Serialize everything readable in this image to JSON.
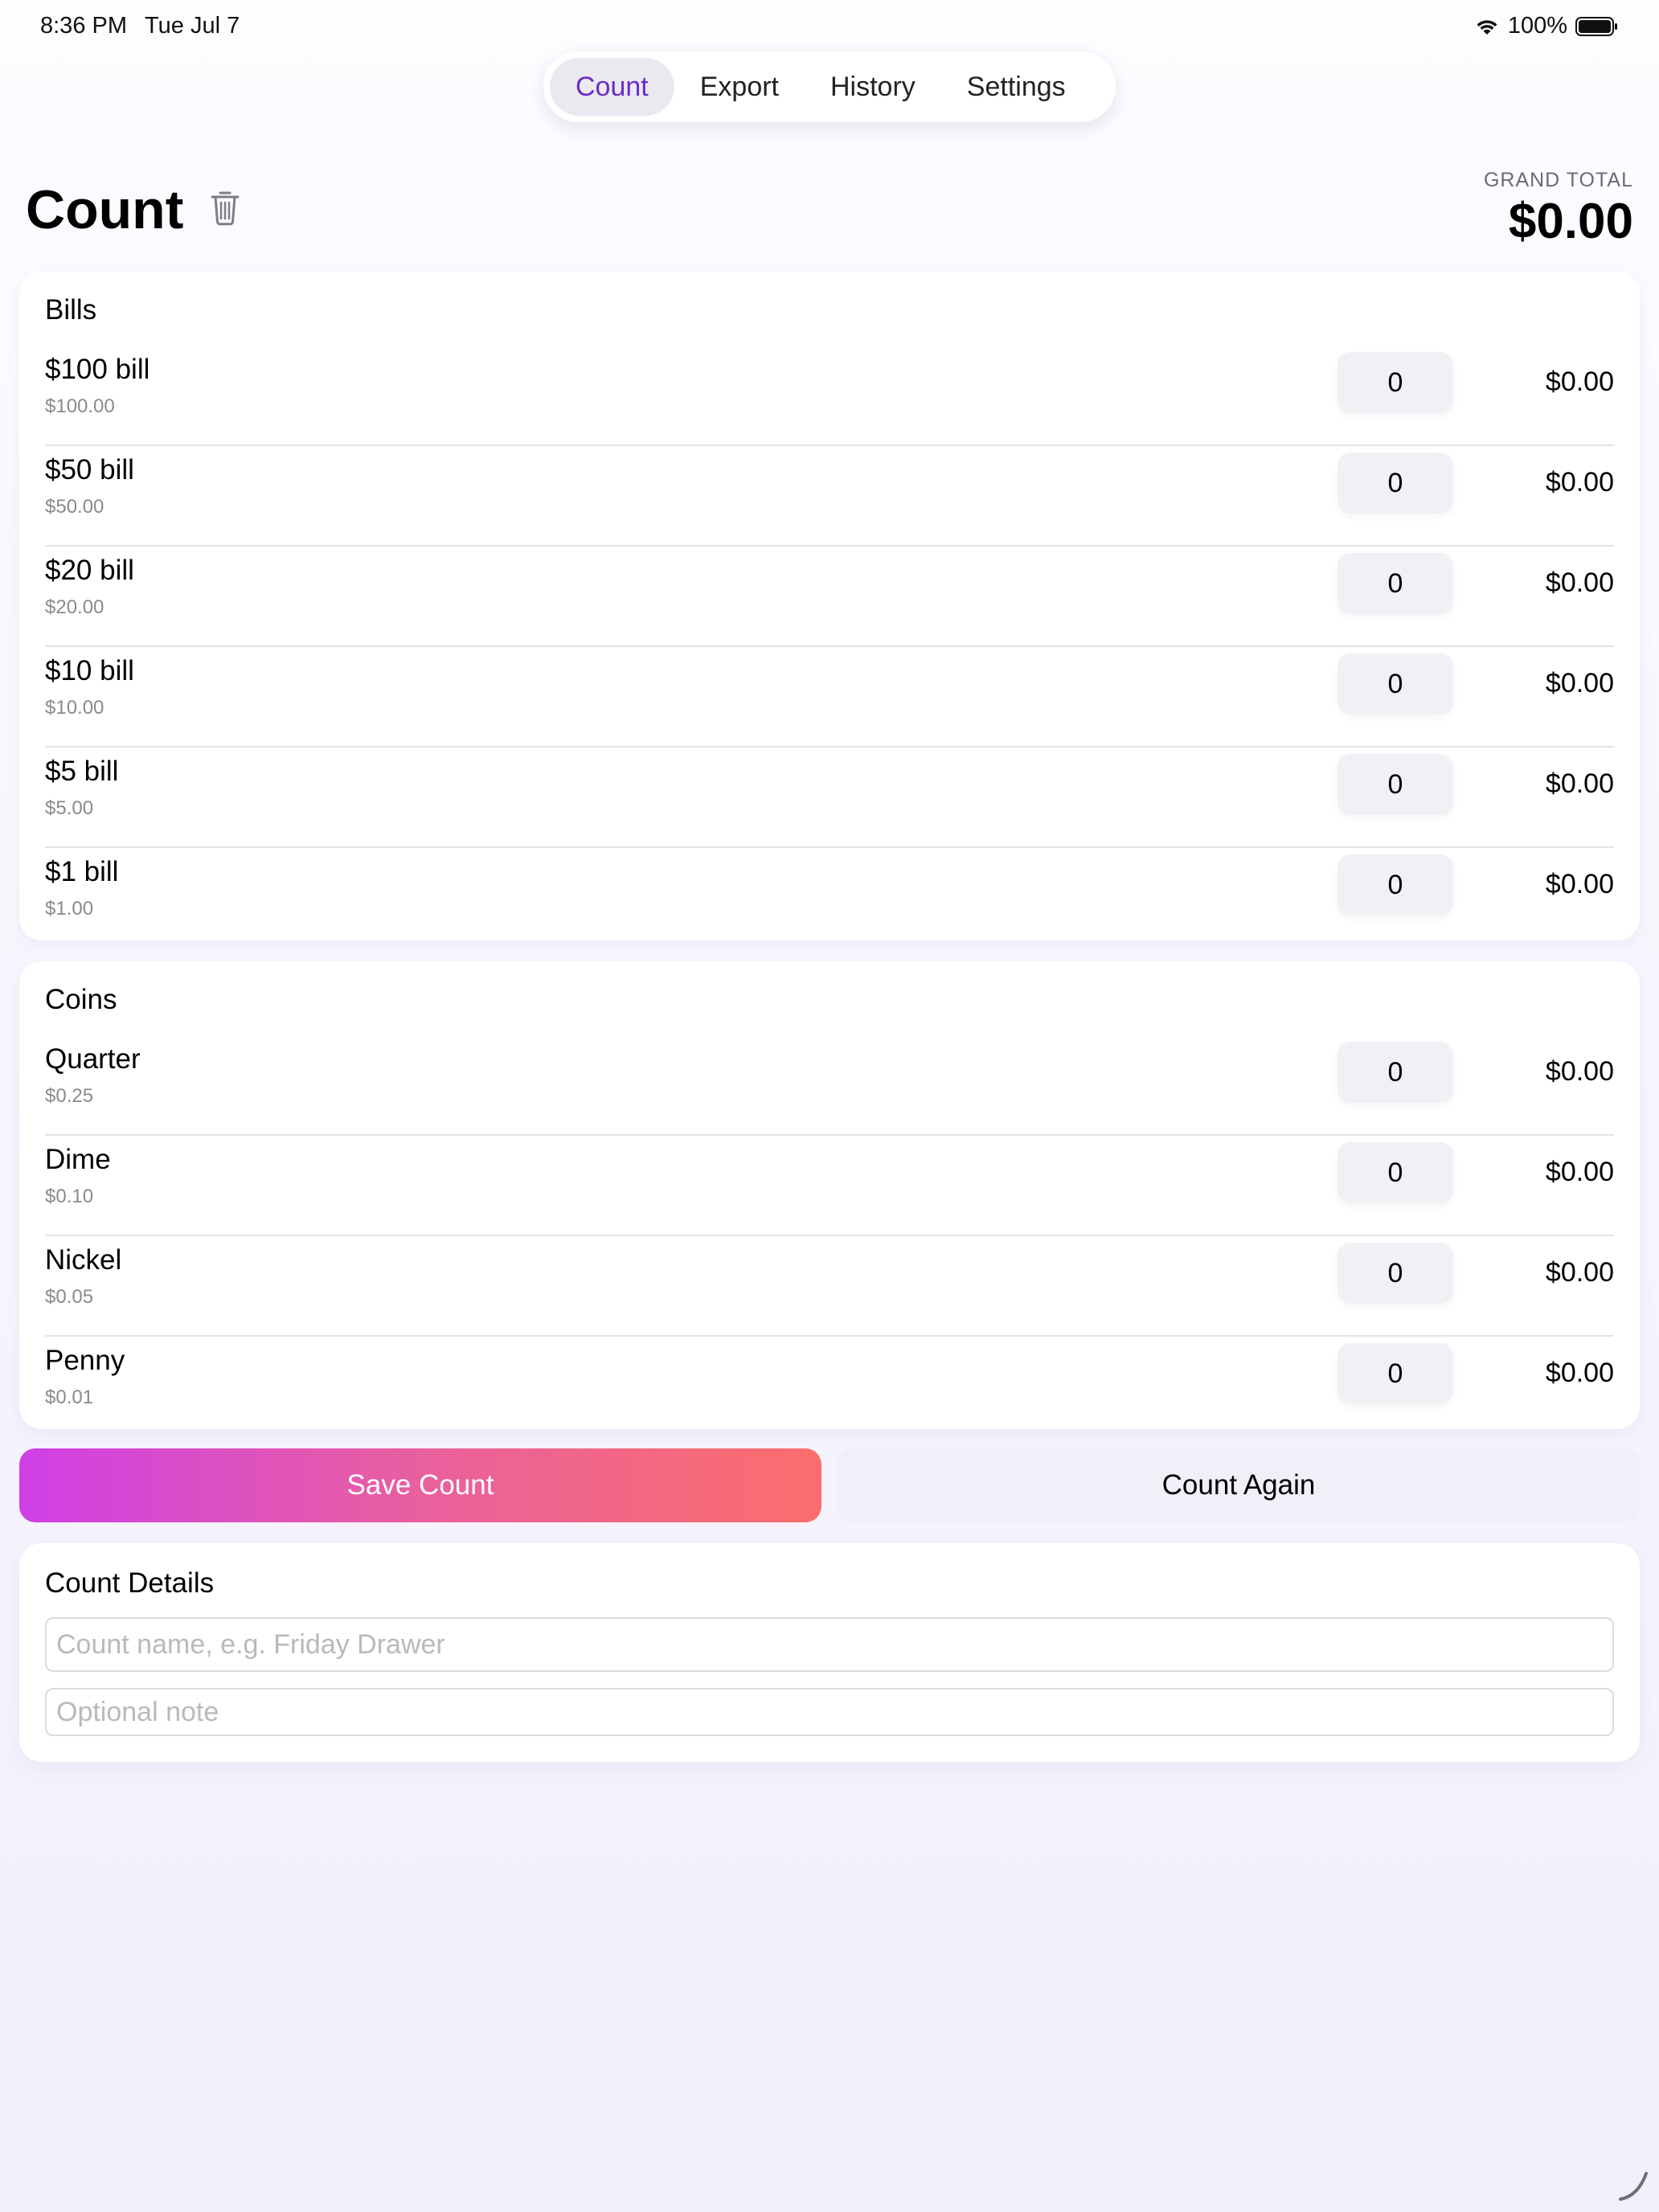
{
  "status_bar": {
    "time": "8:36 PM",
    "date": "Tue Jul 7",
    "battery": "100%",
    "icons": [
      "wifi-icon",
      "battery-icon"
    ]
  },
  "tabs": [
    {
      "label": "Count",
      "active": true
    },
    {
      "label": "Export",
      "active": false
    },
    {
      "label": "History",
      "active": false
    },
    {
      "label": "Settings",
      "active": false
    }
  ],
  "header": {
    "title": "Count",
    "grand_total_label": "GRAND TOTAL",
    "grand_total_value": "$0.00",
    "icon": "trash-icon"
  },
  "bills": {
    "title": "Bills",
    "rows": [
      {
        "name": "$100 bill",
        "value": "$100.00",
        "qty": "0",
        "total": "$0.00"
      },
      {
        "name": "$50 bill",
        "value": "$50.00",
        "qty": "0",
        "total": "$0.00"
      },
      {
        "name": "$20 bill",
        "value": "$20.00",
        "qty": "0",
        "total": "$0.00"
      },
      {
        "name": "$10 bill",
        "value": "$10.00",
        "qty": "0",
        "total": "$0.00"
      },
      {
        "name": "$5 bill",
        "value": "$5.00",
        "qty": "0",
        "total": "$0.00"
      },
      {
        "name": "$1 bill",
        "value": "$1.00",
        "qty": "0",
        "total": "$0.00"
      }
    ]
  },
  "coins": {
    "title": "Coins",
    "rows": [
      {
        "name": "Quarter",
        "value": "$0.25",
        "qty": "0",
        "total": "$0.00"
      },
      {
        "name": "Dime",
        "value": "$0.10",
        "qty": "0",
        "total": "$0.00"
      },
      {
        "name": "Nickel",
        "value": "$0.05",
        "qty": "0",
        "total": "$0.00"
      },
      {
        "name": "Penny",
        "value": "$0.01",
        "qty": "0",
        "total": "$0.00"
      }
    ]
  },
  "actions": {
    "save_label": "Save Count",
    "count_again_label": "Count Again"
  },
  "details": {
    "title": "Count Details",
    "name_value": "",
    "name_placeholder": "Count name, e.g. Friday Drawer",
    "note_value": "",
    "note_placeholder": "Optional note"
  },
  "colors": {
    "accent": "#6a2bc9",
    "save_gradient_start": "#cf3fe6",
    "save_gradient_end": "#fb6e6c",
    "background": "#f2effb"
  }
}
